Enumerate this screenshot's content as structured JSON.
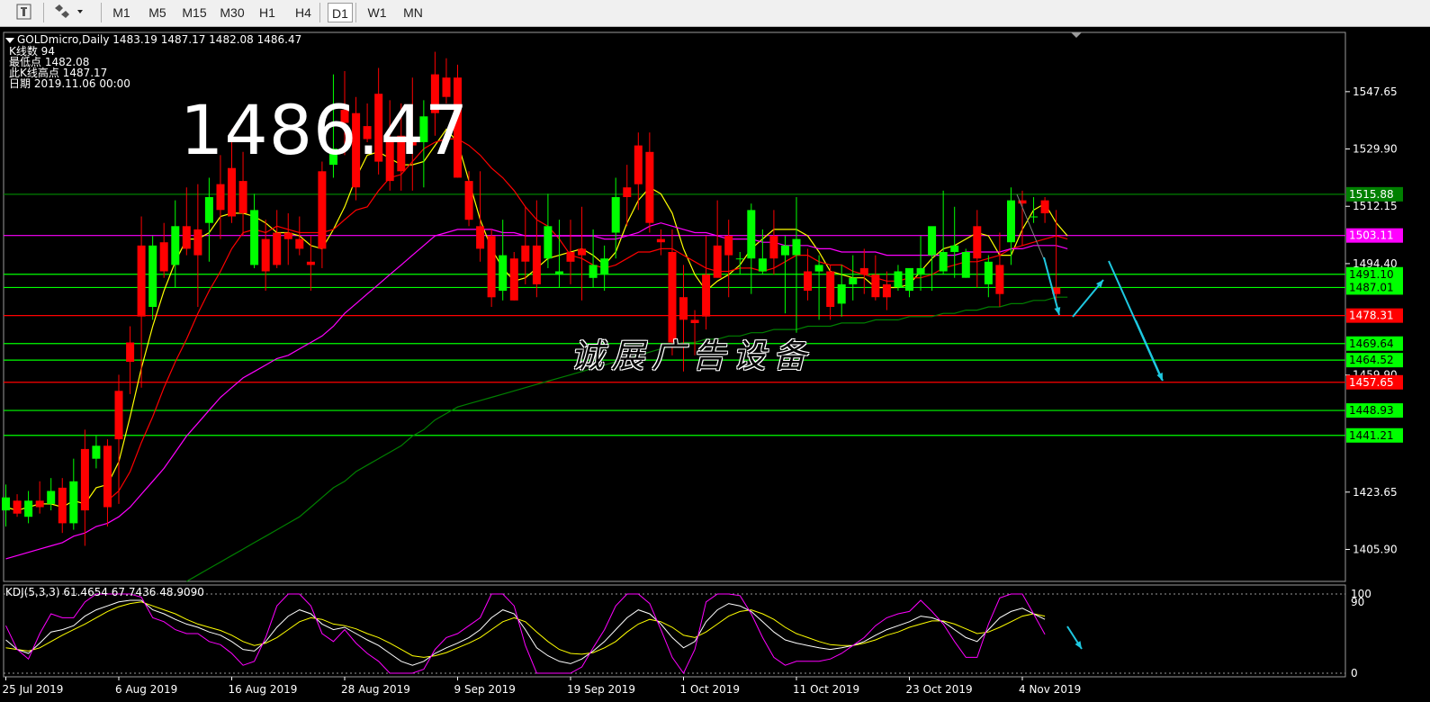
{
  "toolbar": {
    "timeframes": [
      "M1",
      "M5",
      "M15",
      "M30",
      "H1",
      "H4",
      "D1",
      "W1",
      "MN"
    ],
    "active": "D1"
  },
  "header": {
    "title": "GOLDmicro,Daily  1483.19 1487.17 1482.08 1486.47",
    "bars_line": "K线数  94",
    "low_line": "最低点  1482.08",
    "high_line": "此K线高点  1487.17",
    "date_line": "日期  2019.11.06 00:00"
  },
  "big_price": "1486.47",
  "watermark": "诚展广告设备",
  "kdj_label": "KDJ(5,3,3) 61.4654 67.7436 48.9090",
  "colors": {
    "bull": "#00ff00",
    "bear": "#ff0000",
    "ma_fast": "#ffff00",
    "ma_mid": "#ff0000",
    "ma_slow": "#ff00ff",
    "ma_long": "#008000",
    "arrow": "#1ec8e0",
    "price_axis": "#ffffff"
  },
  "chart_data": {
    "type": "candlestick",
    "symbol": "GOLDmicro",
    "timeframe": "Daily",
    "ylim": [
      1396,
      1566
    ],
    "y_ticks": [
      1405.9,
      1423.65,
      1459.9,
      1494.4,
      1512.15,
      1529.9,
      1547.65
    ],
    "x_tick_labels": [
      "25 Jul 2019",
      "6 Aug 2019",
      "16 Aug 2019",
      "28 Aug 2019",
      "9 Sep 2019",
      "19 Sep 2019",
      "1 Oct 2019",
      "11 Oct 2019",
      "23 Oct 2019",
      "4 Nov 2019"
    ],
    "candles": [
      [
        1418,
        1426,
        1413,
        1422
      ],
      [
        1421,
        1423,
        1416,
        1417
      ],
      [
        1416,
        1424,
        1414,
        1421
      ],
      [
        1421,
        1427,
        1417,
        1419
      ],
      [
        1420,
        1428,
        1418,
        1424
      ],
      [
        1425,
        1428,
        1411,
        1414
      ],
      [
        1414,
        1434,
        1412,
        1427
      ],
      [
        1437,
        1443,
        1407,
        1418
      ],
      [
        1434,
        1441,
        1431,
        1438
      ],
      [
        1438,
        1440,
        1413,
        1419
      ],
      [
        1455,
        1460,
        1420,
        1440
      ],
      [
        1470,
        1475,
        1454,
        1464
      ],
      [
        1500,
        1509,
        1456,
        1478
      ],
      [
        1481,
        1503,
        1477,
        1500
      ],
      [
        1501,
        1507,
        1490,
        1492
      ],
      [
        1494,
        1514,
        1487,
        1506
      ],
      [
        1506,
        1518,
        1497,
        1499
      ],
      [
        1505,
        1519,
        1481,
        1497
      ],
      [
        1507,
        1521,
        1495,
        1515
      ],
      [
        1519,
        1528,
        1502,
        1511
      ],
      [
        1524,
        1536,
        1507,
        1509
      ],
      [
        1520,
        1529,
        1503,
        1510
      ],
      [
        1494,
        1516,
        1493,
        1511
      ],
      [
        1502,
        1508,
        1486,
        1492
      ],
      [
        1504,
        1511,
        1493,
        1494
      ],
      [
        1504,
        1510,
        1494,
        1502
      ],
      [
        1502,
        1509,
        1497,
        1499
      ],
      [
        1495,
        1503,
        1486,
        1494
      ],
      [
        1523,
        1526,
        1493,
        1499
      ],
      [
        1525,
        1553,
        1521,
        1530
      ],
      [
        1542,
        1554,
        1528,
        1538
      ],
      [
        1541,
        1546,
        1514,
        1518
      ],
      [
        1537,
        1544,
        1532,
        1533
      ],
      [
        1547,
        1555,
        1522,
        1526
      ],
      [
        1532,
        1545,
        1517,
        1520
      ],
      [
        1534,
        1544,
        1517,
        1523
      ],
      [
        1533,
        1552,
        1517,
        1531
      ],
      [
        1532,
        1545,
        1518,
        1540
      ],
      [
        1553,
        1560,
        1534,
        1541
      ],
      [
        1552,
        1558,
        1544,
        1546
      ],
      [
        1552,
        1556,
        1521,
        1521
      ],
      [
        1520,
        1523,
        1506,
        1508
      ],
      [
        1506,
        1523,
        1495,
        1499
      ],
      [
        1503,
        1505,
        1481,
        1484
      ],
      [
        1486,
        1508,
        1483,
        1497
      ],
      [
        1496,
        1498,
        1483,
        1483
      ],
      [
        1500,
        1512,
        1488,
        1495
      ],
      [
        1500,
        1514,
        1484,
        1488
      ],
      [
        1496,
        1516,
        1493,
        1506
      ],
      [
        1491,
        1508,
        1487,
        1492
      ],
      [
        1498,
        1508,
        1488,
        1495
      ],
      [
        1499,
        1512,
        1483,
        1497
      ],
      [
        1490,
        1505,
        1487,
        1494
      ],
      [
        1491,
        1500,
        1486,
        1496
      ],
      [
        1504,
        1521,
        1496,
        1515
      ],
      [
        1518,
        1525,
        1506,
        1515
      ],
      [
        1531,
        1535,
        1511,
        1519
      ],
      [
        1529,
        1535,
        1504,
        1507
      ],
      [
        1502,
        1505,
        1497,
        1501
      ],
      [
        1498,
        1505,
        1466,
        1470
      ],
      [
        1484,
        1494,
        1461,
        1477
      ],
      [
        1477,
        1480,
        1466,
        1476
      ],
      [
        1491,
        1503,
        1474,
        1478
      ],
      [
        1500,
        1514,
        1490,
        1490
      ],
      [
        1503,
        1508,
        1484,
        1497
      ],
      [
        1496,
        1498,
        1491,
        1496
      ],
      [
        1496,
        1513,
        1485,
        1511
      ],
      [
        1492,
        1505,
        1491,
        1496
      ],
      [
        1503,
        1511,
        1491,
        1496
      ],
      [
        1497,
        1503,
        1479,
        1500
      ],
      [
        1497,
        1515,
        1473,
        1502
      ],
      [
        1492,
        1499,
        1483,
        1486
      ],
      [
        1492,
        1497,
        1477,
        1494
      ],
      [
        1492,
        1494,
        1477,
        1481
      ],
      [
        1482,
        1494,
        1478,
        1488
      ],
      [
        1488,
        1497,
        1483,
        1490
      ],
      [
        1493,
        1499,
        1485,
        1491
      ],
      [
        1491,
        1497,
        1483,
        1484
      ],
      [
        1488,
        1492,
        1480,
        1484
      ],
      [
        1487,
        1494,
        1486,
        1492
      ],
      [
        1486,
        1493,
        1484,
        1493
      ],
      [
        1491,
        1503,
        1486,
        1493
      ],
      [
        1497,
        1505,
        1486,
        1506
      ],
      [
        1492,
        1517,
        1491,
        1498
      ],
      [
        1498,
        1512,
        1490,
        1500
      ],
      [
        1490,
        1499,
        1490,
        1498
      ],
      [
        1506,
        1511,
        1487,
        1496
      ],
      [
        1488,
        1497,
        1484,
        1495
      ],
      [
        1494,
        1504,
        1481,
        1485
      ],
      [
        1501,
        1518,
        1494,
        1514
      ],
      [
        1514,
        1517,
        1500,
        1513
      ],
      [
        1509,
        1515,
        1507,
        1509
      ],
      [
        1514,
        1515,
        1507,
        1510
      ],
      [
        1487,
        1511,
        1482,
        1485
      ]
    ],
    "horizontal_levels": [
      {
        "price": 1515.88,
        "label": "1515.88",
        "color": "#008000"
      },
      {
        "price": 1503.11,
        "label": "1503.11",
        "color": "#ff00ff"
      },
      {
        "price": 1491.1,
        "label": "1491.10",
        "color": "#00ff00"
      },
      {
        "price": 1487.01,
        "label": "1487.01",
        "color": "#00ff00"
      },
      {
        "price": 1478.31,
        "label": "1478.31",
        "color": "#ff0000"
      },
      {
        "price": 1469.64,
        "label": "1469.64",
        "color": "#00ff00"
      },
      {
        "price": 1464.52,
        "label": "1464.52",
        "color": "#00ff00"
      },
      {
        "price": 1457.65,
        "label": "1457.65",
        "color": "#ff0000"
      },
      {
        "price": 1448.93,
        "label": "1448.93",
        "color": "#00ff00"
      },
      {
        "price": 1441.21,
        "label": "1441.21",
        "color": "#00ff00"
      }
    ],
    "moving_averages": [
      {
        "color": "#ffff00",
        "values": [
          1419,
          1418,
          1419,
          1420,
          1420,
          1419,
          1421,
          1420,
          1425,
          1426,
          1433,
          1447,
          1462,
          1475,
          1486,
          1495,
          1502,
          1502,
          1504,
          1509,
          1510,
          1510,
          1509,
          1507,
          1504,
          1504,
          1503,
          1500,
          1499,
          1505,
          1512,
          1521,
          1528,
          1529,
          1527,
          1525,
          1525,
          1526,
          1531,
          1536,
          1532,
          1520,
          1508,
          1499,
          1493,
          1489,
          1490,
          1493,
          1496,
          1497,
          1498,
          1499,
          1497,
          1494,
          1498,
          1507,
          1514,
          1518,
          1516,
          1510,
          1499,
          1491,
          1486,
          1489,
          1491,
          1494,
          1499,
          1502,
          1505,
          1505,
          1505,
          1503,
          1498,
          1492,
          1491,
          1490,
          1490,
          1487,
          1487,
          1487,
          1488,
          1492,
          1496,
          1499,
          1500,
          1502,
          1504,
          1503,
          1497,
          1497,
          1505,
          1511,
          1513,
          1507,
          1503
        ]
      },
      {
        "color": "#ff0000",
        "values": [
          null,
          null,
          null,
          null,
          null,
          null,
          null,
          null,
          null,
          1421,
          1424,
          1430,
          1439,
          1447,
          1456,
          1464,
          1471,
          1479,
          1486,
          1492,
          1499,
          1504,
          1505,
          1504,
          1506,
          1505,
          1504,
          1504,
          1504,
          1505,
          1508,
          1511,
          1512,
          1517,
          1521,
          1522,
          1526,
          1530,
          1532,
          1533,
          1533,
          1531,
          1528,
          1524,
          1521,
          1517,
          1512,
          1508,
          1506,
          1502,
          1497,
          1496,
          1494,
          1493,
          1494,
          1496,
          1498,
          1498,
          1499,
          1499,
          1497,
          1495,
          1493,
          1492,
          1492,
          1493,
          1493,
          1492,
          1493,
          1495,
          1497,
          1497,
          1495,
          1494,
          1494,
          1492,
          1491,
          1490,
          1489,
          1489,
          1490,
          1490,
          1491,
          1493,
          1494,
          1495,
          1495,
          1496,
          1497,
          1499,
          1500,
          1501,
          1502,
          1503,
          1502
        ]
      },
      {
        "color": "#ff00ff",
        "values": [
          1403,
          1404,
          1405,
          1406,
          1407,
          1408,
          1410,
          1411,
          1413,
          1414,
          1416,
          1419,
          1423,
          1427,
          1431,
          1436,
          1441,
          1445,
          1449,
          1453,
          1456,
          1459,
          1461,
          1463,
          1465,
          1466,
          1468,
          1470,
          1472,
          1475,
          1479,
          1482,
          1485,
          1488,
          1491,
          1494,
          1497,
          1500,
          1503,
          1504,
          1505,
          1505,
          1505,
          1505,
          1504,
          1504,
          1503,
          1503,
          1503,
          1503,
          1503,
          1503,
          1503,
          1502,
          1502,
          1503,
          1504,
          1506,
          1507,
          1506,
          1505,
          1504,
          1504,
          1503,
          1502,
          1502,
          1502,
          1501,
          1501,
          1500,
          1500,
          1500,
          1499,
          1499,
          1498,
          1498,
          1498,
          1498,
          1497,
          1497,
          1497,
          1497,
          1497,
          1497,
          1497,
          1498,
          1498,
          1498,
          1498,
          1499,
          1499,
          1500,
          1500,
          1500,
          1499
        ]
      },
      {
        "color": "#008000",
        "values": [
          null,
          null,
          null,
          null,
          null,
          null,
          null,
          null,
          null,
          null,
          null,
          null,
          null,
          null,
          null,
          null,
          1396,
          1398,
          1400,
          1402,
          1404,
          1406,
          1408,
          1410,
          1412,
          1414,
          1416,
          1419,
          1422,
          1425,
          1427,
          1430,
          1432,
          1434,
          1436,
          1438,
          1441,
          1443,
          1446,
          1448,
          1450,
          1451,
          1452,
          1453,
          1454,
          1455,
          1456,
          1457,
          1458,
          1459,
          1460,
          1461,
          1462,
          1463,
          1464,
          1465,
          1466,
          1467,
          1468,
          1469,
          1470,
          1470,
          1471,
          1471,
          1472,
          1472,
          1473,
          1473,
          1474,
          1474,
          1474,
          1475,
          1475,
          1475,
          1476,
          1476,
          1476,
          1477,
          1477,
          1477,
          1478,
          1478,
          1478,
          1479,
          1479,
          1480,
          1480,
          1481,
          1481,
          1482,
          1482,
          1483,
          1483,
          1484,
          1484
        ]
      }
    ],
    "kdj": {
      "ylim": [
        0,
        100
      ],
      "y_ticks": [
        0,
        90,
        100
      ],
      "k": [
        42,
        30,
        25,
        38,
        52,
        55,
        60,
        72,
        80,
        85,
        90,
        92,
        92,
        80,
        75,
        68,
        62,
        58,
        52,
        48,
        40,
        30,
        28,
        40,
        58,
        72,
        80,
        75,
        62,
        55,
        58,
        50,
        42,
        35,
        25,
        15,
        10,
        15,
        25,
        32,
        38,
        45,
        55,
        70,
        80,
        75,
        55,
        32,
        22,
        15,
        12,
        18,
        28,
        40,
        55,
        70,
        80,
        75,
        62,
        45,
        32,
        40,
        65,
        80,
        88,
        85,
        78,
        65,
        52,
        42,
        38,
        35,
        32,
        30,
        32,
        35,
        40,
        48,
        55,
        60,
        65,
        72,
        70,
        65,
        55,
        45,
        40,
        55,
        70,
        78,
        82,
        75,
        68
      ],
      "d": [
        32,
        30,
        28,
        32,
        40,
        48,
        55,
        62,
        70,
        78,
        84,
        88,
        90,
        85,
        80,
        75,
        68,
        62,
        58,
        54,
        48,
        40,
        35,
        38,
        45,
        55,
        65,
        70,
        68,
        62,
        60,
        56,
        50,
        45,
        38,
        30,
        22,
        20,
        22,
        26,
        32,
        38,
        45,
        55,
        65,
        70,
        65,
        52,
        40,
        30,
        25,
        24,
        26,
        32,
        40,
        52,
        62,
        68,
        65,
        58,
        48,
        45,
        52,
        62,
        72,
        78,
        80,
        75,
        68,
        58,
        50,
        45,
        40,
        36,
        35,
        35,
        38,
        42,
        48,
        52,
        58,
        62,
        66,
        66,
        62,
        56,
        50,
        52,
        58,
        65,
        72,
        75,
        72
      ],
      "j": [
        60,
        30,
        18,
        50,
        75,
        70,
        70,
        90,
        100,
        100,
        100,
        100,
        96,
        70,
        65,
        55,
        50,
        50,
        40,
        36,
        25,
        10,
        15,
        45,
        85,
        100,
        100,
        85,
        50,
        40,
        55,
        38,
        25,
        15,
        0,
        0,
        0,
        5,
        30,
        45,
        50,
        60,
        70,
        100,
        100,
        85,
        35,
        0,
        0,
        0,
        0,
        8,
        32,
        55,
        85,
        100,
        100,
        88,
        55,
        20,
        0,
        30,
        90,
        100,
        100,
        98,
        75,
        45,
        20,
        10,
        15,
        15,
        15,
        18,
        25,
        35,
        45,
        60,
        70,
        75,
        78,
        92,
        78,
        62,
        40,
        20,
        20,
        62,
        95,
        100,
        100,
        75,
        49
      ]
    }
  }
}
